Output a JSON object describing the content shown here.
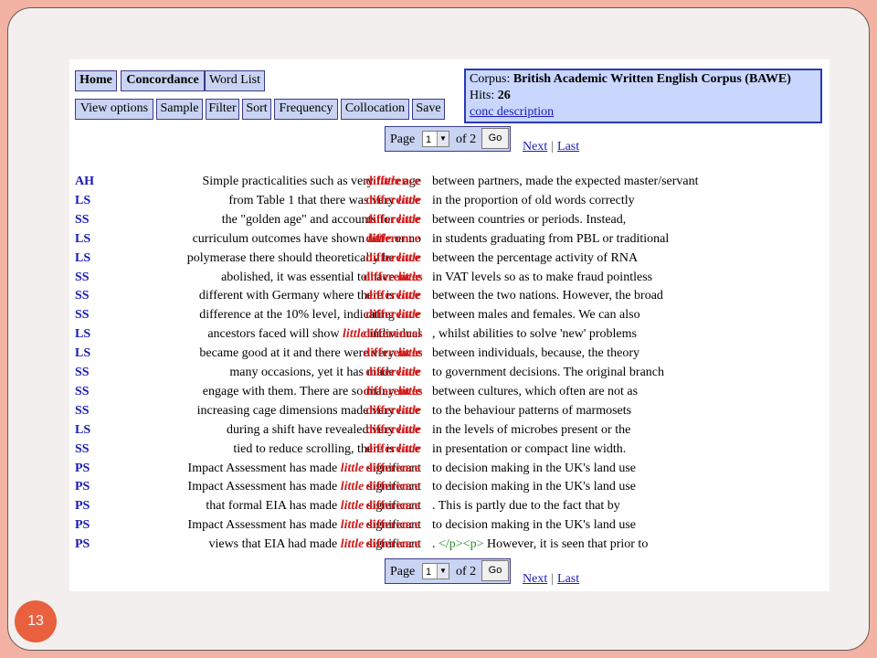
{
  "toolbar": {
    "row1": [
      "Home",
      "Concordance",
      "Word List"
    ],
    "row2": [
      "View options",
      "Sample",
      "Filter",
      "Sort",
      "Frequency",
      "Collocation",
      "Save"
    ]
  },
  "corpus": {
    "corpus_label": "Corpus:",
    "corpus_name": "British Academic Written English Corpus (BAWE)",
    "hits_label": "Hits:",
    "hits_value": "26",
    "desc_link": "conc description"
  },
  "pager": {
    "page_label": "Page",
    "page_value": "1",
    "of_label": "of 2",
    "go_label": "Go",
    "next_label": "Next",
    "sep": "|",
    "last_label": "Last"
  },
  "concordance": [
    {
      "code": "AH",
      "left": "Simple practicalities such as very ",
      "node": "little",
      "after": " age",
      "kw": "difference",
      "right": "between partners, made the expected master/servant"
    },
    {
      "code": "LS",
      "left": "from Table 1 that there was very ",
      "node": "little",
      "after": "",
      "kw": "difference",
      "right": "in the proportion of old words correctly"
    },
    {
      "code": "SS",
      "left": "the \"golden age\" and accounts for ",
      "node": "little",
      "after": "",
      "kw": "difference",
      "right": "between countries or periods. Instead,"
    },
    {
      "code": "LS",
      "left": "curriculum outcomes have shown ",
      "node": "little",
      "after": " or no",
      "kw": "difference",
      "right": "in students graduating from PBL or traditional"
    },
    {
      "code": "LS",
      "left": "polymerase there should theoretically be ",
      "node": "little",
      "after": "",
      "kw": "difference",
      "right": "between the percentage activity of RNA"
    },
    {
      "code": "SS",
      "left": "abolished, it was essential to have ",
      "node": "little",
      "after": "",
      "kw": "differences",
      "right": "in VAT levels so as to make fraud pointless"
    },
    {
      "code": "SS",
      "left": "different with Germany where there is ",
      "node": "little",
      "after": "",
      "kw": "difference",
      "right": "between the two nations. However, the broad"
    },
    {
      "code": "SS",
      "left": "difference at the 10% level, indicating ",
      "node": "little",
      "after": "",
      "kw": "difference",
      "right": "between males and females. We can also"
    },
    {
      "code": "LS",
      "left": "ancestors faced will show ",
      "node": "little",
      "after": " individual",
      "kw": "differences",
      "right": ", whilst abilities to solve 'new' problems"
    },
    {
      "code": "LS",
      "left": "became good at it and there were very ",
      "node": "little",
      "after": "",
      "kw": "differences",
      "right": "between individuals, because, the theory"
    },
    {
      "code": "SS",
      "left": "many occasions, yet it has made ",
      "node": "little",
      "after": "",
      "kw": "difference",
      "right": "to government decisions. The original branch"
    },
    {
      "code": "SS",
      "left": "engage with them. There are so many ",
      "node": "little",
      "after": "",
      "kw": "differences",
      "right": "between cultures, which often are not as"
    },
    {
      "code": "SS",
      "left": "increasing cage dimensions made very ",
      "node": "little",
      "after": "",
      "kw": "difference",
      "right": "to the behaviour patterns of marmosets"
    },
    {
      "code": "LS",
      "left": "during a shift have revealed very ",
      "node": "little",
      "after": "",
      "kw": "difference",
      "right": "in the levels of microbes present or the"
    },
    {
      "code": "SS",
      "left": "tied to reduce scrolling, there is ",
      "node": "little",
      "after": "",
      "kw": "difference",
      "right": "in presentation or compact line width."
    },
    {
      "code": "PS",
      "left": "Impact Assessment has made ",
      "node": "little",
      "after": " significant",
      "kw": "difference",
      "right": "to decision making in the UK's land use"
    },
    {
      "code": "PS",
      "left": "Impact Assessment has made ",
      "node": "little",
      "after": " significant",
      "kw": "difference",
      "right": "to decision making in the UK's land use"
    },
    {
      "code": "PS",
      "left": "that formal EIA has made ",
      "node": "little",
      "after": " significant",
      "kw": "difference",
      "right": ". This is partly due to the fact that by"
    },
    {
      "code": "PS",
      "left": "Impact Assessment has made ",
      "node": "little",
      "after": " significant",
      "kw": "difference",
      "right": "to decision making in the UK's land use"
    },
    {
      "code": "PS",
      "left": "views that EIA had made ",
      "node": "little",
      "after": " significant",
      "kw": "difference",
      "right_prefix": ". ",
      "right_tag": "</p><p>",
      "right": " However, it is seen that prior to"
    }
  ],
  "slide_number": "13"
}
